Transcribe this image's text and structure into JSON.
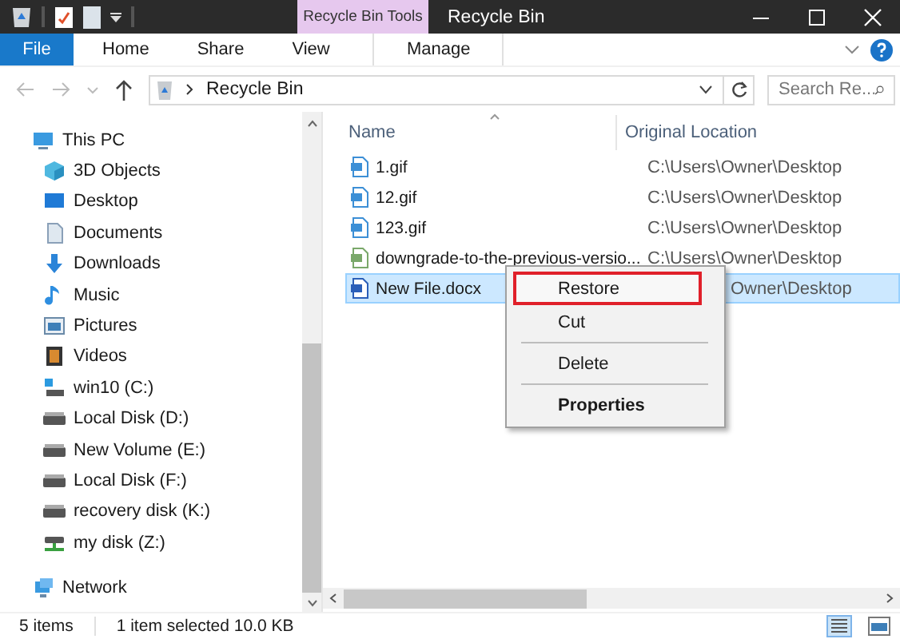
{
  "window": {
    "title": "Recycle Bin",
    "context_tab": "Recycle Bin Tools"
  },
  "ribbon_tabs": [
    {
      "label": "File",
      "kind": "file",
      "selected": false
    },
    {
      "label": "Home",
      "kind": "tab",
      "selected": false
    },
    {
      "label": "Share",
      "kind": "tab",
      "selected": false
    },
    {
      "label": "View",
      "kind": "tab",
      "selected": false
    },
    {
      "label": "Manage",
      "kind": "context",
      "selected": false
    }
  ],
  "address": {
    "path": "Recycle Bin"
  },
  "search": {
    "placeholder": "Search Re..."
  },
  "sidebar": {
    "items": [
      {
        "label": "This PC",
        "kind": "pc",
        "children": [
          {
            "label": "3D Objects",
            "kind": "cube"
          },
          {
            "label": "Desktop",
            "kind": "desktop"
          },
          {
            "label": "Documents",
            "kind": "doc"
          },
          {
            "label": "Downloads",
            "kind": "download"
          },
          {
            "label": "Music",
            "kind": "music"
          },
          {
            "label": "Pictures",
            "kind": "pictures"
          },
          {
            "label": "Videos",
            "kind": "videos"
          },
          {
            "label": "win10 (C:)",
            "kind": "sysdrive"
          },
          {
            "label": "Local Disk (D:)",
            "kind": "drive"
          },
          {
            "label": "New Volume (E:)",
            "kind": "drive"
          },
          {
            "label": "Local Disk (F:)",
            "kind": "drive"
          },
          {
            "label": "recovery disk (K:)",
            "kind": "drive"
          },
          {
            "label": "my disk (Z:)",
            "kind": "netdrive"
          }
        ]
      },
      {
        "label": "Network",
        "kind": "network"
      }
    ]
  },
  "table": {
    "columns": [
      "Name",
      "Original Location"
    ],
    "rows": [
      {
        "name": "1.gif",
        "location": "C:\\Users\\Owner\\Desktop",
        "kind": "image",
        "selected": false
      },
      {
        "name": "12.gif",
        "location": "C:\\Users\\Owner\\Desktop",
        "kind": "image",
        "selected": false
      },
      {
        "name": "123.gif",
        "location": "C:\\Users\\Owner\\Desktop",
        "kind": "image",
        "selected": false
      },
      {
        "name": "downgrade-to-the-previous-versio...",
        "location": "C:\\Users\\Owner\\Desktop",
        "kind": "greenimage",
        "selected": false
      },
      {
        "name": "New File.docx",
        "location": "Owner\\Desktop",
        "kind": "word",
        "selected": true
      }
    ]
  },
  "context_menu": {
    "items": [
      {
        "kind": "item",
        "label": "Restore",
        "highlighted": true,
        "default": false
      },
      {
        "kind": "item",
        "label": "Cut",
        "highlighted": false,
        "default": false
      },
      {
        "kind": "separator"
      },
      {
        "kind": "item",
        "label": "Delete",
        "highlighted": false,
        "default": false
      },
      {
        "kind": "separator"
      },
      {
        "kind": "item",
        "label": "Properties",
        "highlighted": false,
        "default": true
      }
    ]
  },
  "status_bar": {
    "items": "5 items",
    "selection": "1 item selected  10.0 KB"
  }
}
